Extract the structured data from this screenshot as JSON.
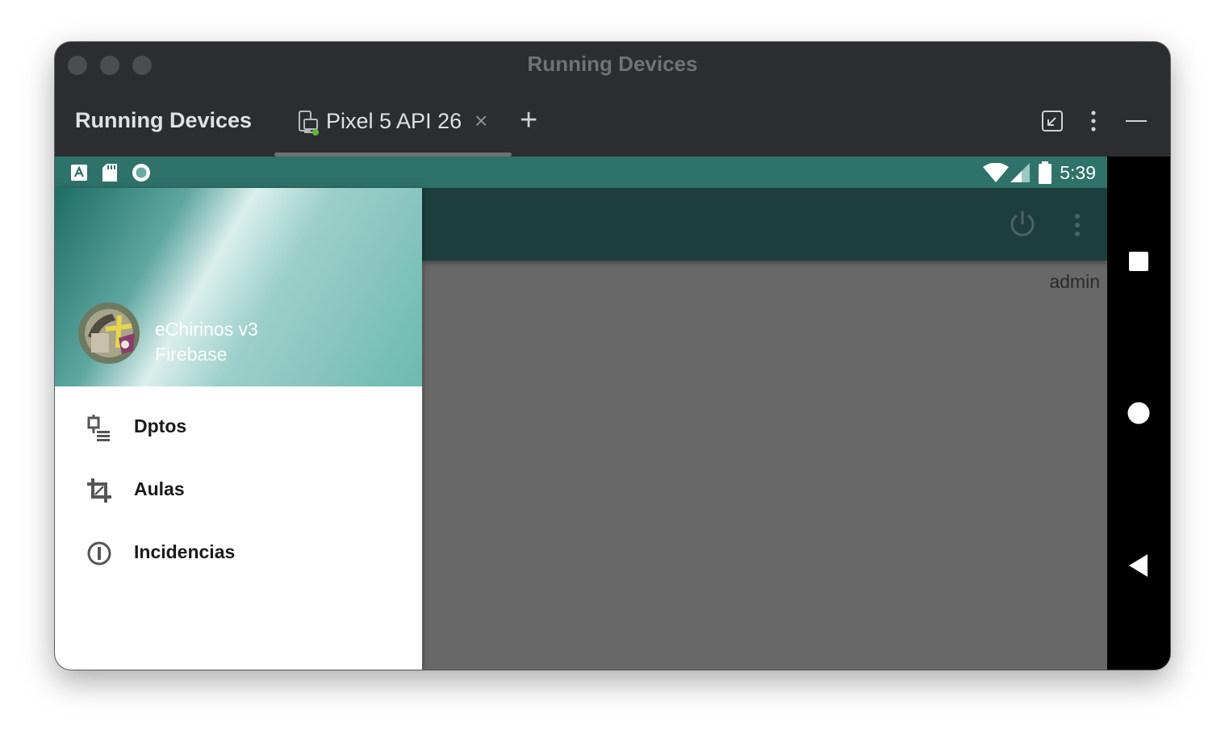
{
  "window": {
    "title": "Running Devices"
  },
  "toolbar": {
    "title": "Running Devices",
    "tab": {
      "label": "Pixel 5 API 26",
      "close": "×",
      "icon": "device-icon"
    },
    "add_tab": "+",
    "icons": [
      "restore-icon",
      "more-vertical-icon",
      "minimize-icon"
    ]
  },
  "device": {
    "status_bar": {
      "time": "5:39",
      "left_icons": [
        "accessibility-icon",
        "sd-card-icon",
        "record-icon"
      ],
      "right_icons": [
        "wifi-icon",
        "signal-icon",
        "battery-icon"
      ],
      "color": "#2f7269"
    },
    "app_bar": {
      "icons": [
        "power-icon",
        "more-vertical-icon"
      ],
      "color": "#1e3e3d"
    },
    "content": {
      "user": "admin"
    },
    "drawer": {
      "title": "eChirinos v3",
      "subtitle": "Firebase",
      "items": [
        {
          "label": "Dptos",
          "icon": "departments-icon"
        },
        {
          "label": "Aulas",
          "icon": "crop-icon"
        },
        {
          "label": "Incidencias",
          "icon": "info-icon"
        }
      ]
    },
    "nav_bar": {
      "buttons": [
        "recents-button",
        "home-button",
        "back-button"
      ]
    }
  }
}
